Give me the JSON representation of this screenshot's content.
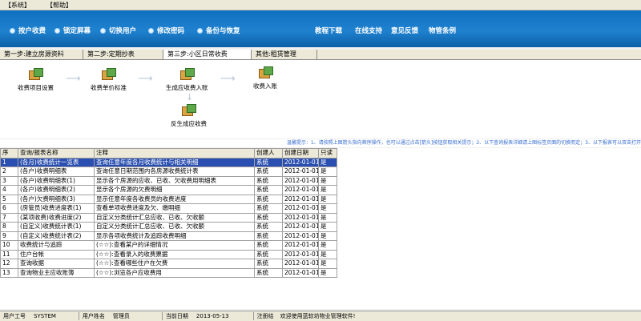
{
  "menu": {
    "system": "【系统】",
    "help": "【帮助】"
  },
  "toolbar": {
    "left": [
      "按户收费",
      "锁定屏幕",
      "切换用户",
      "修改密码",
      "备份与恢复"
    ],
    "right": [
      "教程下载",
      "在线支持",
      "意见反馈",
      "物管条例"
    ]
  },
  "tabs": [
    "第一步:建立房源资料",
    "第二步:定期抄表",
    "第三步:小区日常收费",
    "其他:租赁管理"
  ],
  "flow": {
    "items": [
      "收费项目设置",
      "收费单价标准",
      "生成应收费入账",
      "收费入账",
      "反生成应收费"
    ]
  },
  "hint": "温馨提示：1、请按照上图箭头指向顺序操作，也可以通过点击[箭头]按钮获取相关提示；2、以下查询报表详细请上图标签页面的切换而定；3、以下报表可以双击打开",
  "table": {
    "headers": [
      "序",
      "查询/报表名称",
      "注释",
      "创建人",
      "创建日期",
      "只读"
    ],
    "rows": [
      [
        "1",
        "(各月)收费统计一览表",
        "查询任意年度各月收费统计与相关明细",
        "系统",
        "2012-01-01",
        "是"
      ],
      [
        "2",
        "(各户)收费明细表",
        "查询任意日期范围内各房源收费统计表",
        "系统",
        "2012-01-01",
        "是"
      ],
      [
        "3",
        "(各户)收费明细表(1)",
        "显示各个房源的应收、已收、欠收费用明细表",
        "系统",
        "2012-01-01",
        "是"
      ],
      [
        "4",
        "(各户)收费明细表(2)",
        "显示各个房源的欠费明细",
        "系统",
        "2012-01-01",
        "是"
      ],
      [
        "5",
        "(各户)欠费明细表(3)",
        "显示任意年度各收费员的收费进度",
        "系统",
        "2012-01-01",
        "是"
      ],
      [
        "6",
        "(房管员)收费进度表(1)",
        "查看单项收费进度及欠、缴明细",
        "系统",
        "2012-01-01",
        "是"
      ],
      [
        "7",
        "(某项收费)收费进度(2)",
        "自定义分类统计汇总应收、已收、欠收额",
        "系统",
        "2012-01-01",
        "是"
      ],
      [
        "8",
        "(自定义)收费统计表(1)",
        "自定义分类统计汇总应收、已收、欠收额",
        "系统",
        "2012-01-01",
        "是"
      ],
      [
        "9",
        "(自定义)收费统计表(2)",
        "显示各项收费统计及追踪收费明细",
        "系统",
        "2012-01-01",
        "是"
      ],
      [
        "10",
        "收费统计与追踪",
        "(☆☆):查看某户的详细情况",
        "系统",
        "2012-01-01",
        "是"
      ],
      [
        "11",
        "住户台帐",
        "(☆☆):查看录入的收费票据",
        "系统",
        "2012-01-01",
        "是"
      ],
      [
        "12",
        "查询收据",
        "(☆☆):查看哪些住户在欠费",
        "系统",
        "2012-01-01",
        "是"
      ],
      [
        "13",
        "查询物业主应收账簿",
        "(☆☆):浏览各户应收费用",
        "系统",
        "2012-01-01",
        "是"
      ]
    ]
  },
  "status": {
    "user_no_label": "用户工号",
    "user_no": "SYSTEM",
    "user_name_label": "用户姓名",
    "user_name": "管理员",
    "date_label": "当前日期",
    "date": "2013-05-13",
    "reg_label": "注册给",
    "reg": "欢迎使用蓝软坊物业管理软件!"
  }
}
